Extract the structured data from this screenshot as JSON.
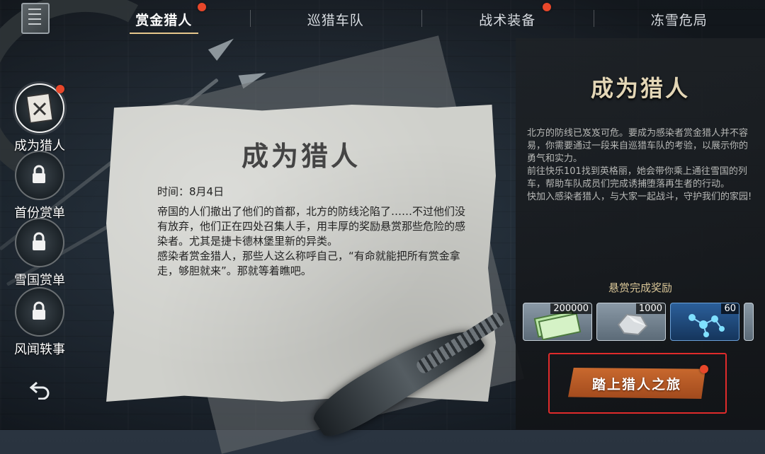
{
  "top_tabs": [
    {
      "label": "赏金猎人",
      "active": true,
      "badge": true
    },
    {
      "label": "巡猎车队",
      "active": false,
      "badge": false
    },
    {
      "label": "战术装备",
      "active": false,
      "badge": true
    },
    {
      "label": "冻雪危局",
      "active": false,
      "badge": false
    }
  ],
  "sidebar": {
    "items": [
      {
        "label": "成为猎人",
        "icon": "bounty-poster-icon",
        "active": true,
        "locked": false,
        "badge": true
      },
      {
        "label": "首份赏单",
        "icon": "lock-icon",
        "active": false,
        "locked": true,
        "badge": false
      },
      {
        "label": "雪国赏单",
        "icon": "lock-icon",
        "active": false,
        "locked": true,
        "badge": false
      },
      {
        "label": "风闻轶事",
        "icon": "lock-icon",
        "active": false,
        "locked": true,
        "badge": false
      }
    ],
    "back_icon": "back-arrow-icon"
  },
  "paper": {
    "title": "成为猎人",
    "date": "时间：8月4日",
    "paragraphs": [
      "帝国的人们撤出了他们的首都，北方的防线沦陷了……不过他们没有放弃，他们正在四处召集人手，用丰厚的奖励悬赏那些危险的感染者。尤其是捷卡德林堡里新的异类。",
      "感染者赏金猎人，那些人这么称呼自己，“有命就能把所有赏金拿走，够胆就来”。那就等着瞧吧。"
    ]
  },
  "panel": {
    "title": "成为猎人",
    "paragraphs": [
      "北方的防线已岌岌可危。要成为感染者赏金猎人并不容易，你需要通过一段来自巡猎车队的考验，以展示你的勇气和实力。",
      "前往快乐101找到英格丽，她会带你乘上通往雪国的列车，帮助车队成员们完成诱捕堕落再生者的行动。",
      "快加入感染者猎人，与大家一起战斗，守护我们的家园!"
    ],
    "reward_heading": "悬赏完成奖励",
    "rewards": [
      {
        "item": "cash-voucher-icon",
        "count": "200000"
      },
      {
        "item": "silver-ore-icon",
        "count": "1000"
      },
      {
        "item": "molecule-icon",
        "count": "60"
      }
    ],
    "cta_label": "踏上猎人之旅"
  },
  "colors": {
    "badge": "#e8472a",
    "cta": "#b8582a",
    "highlight_frame": "#e02b2b",
    "title_gold": "#e3d6b6"
  }
}
